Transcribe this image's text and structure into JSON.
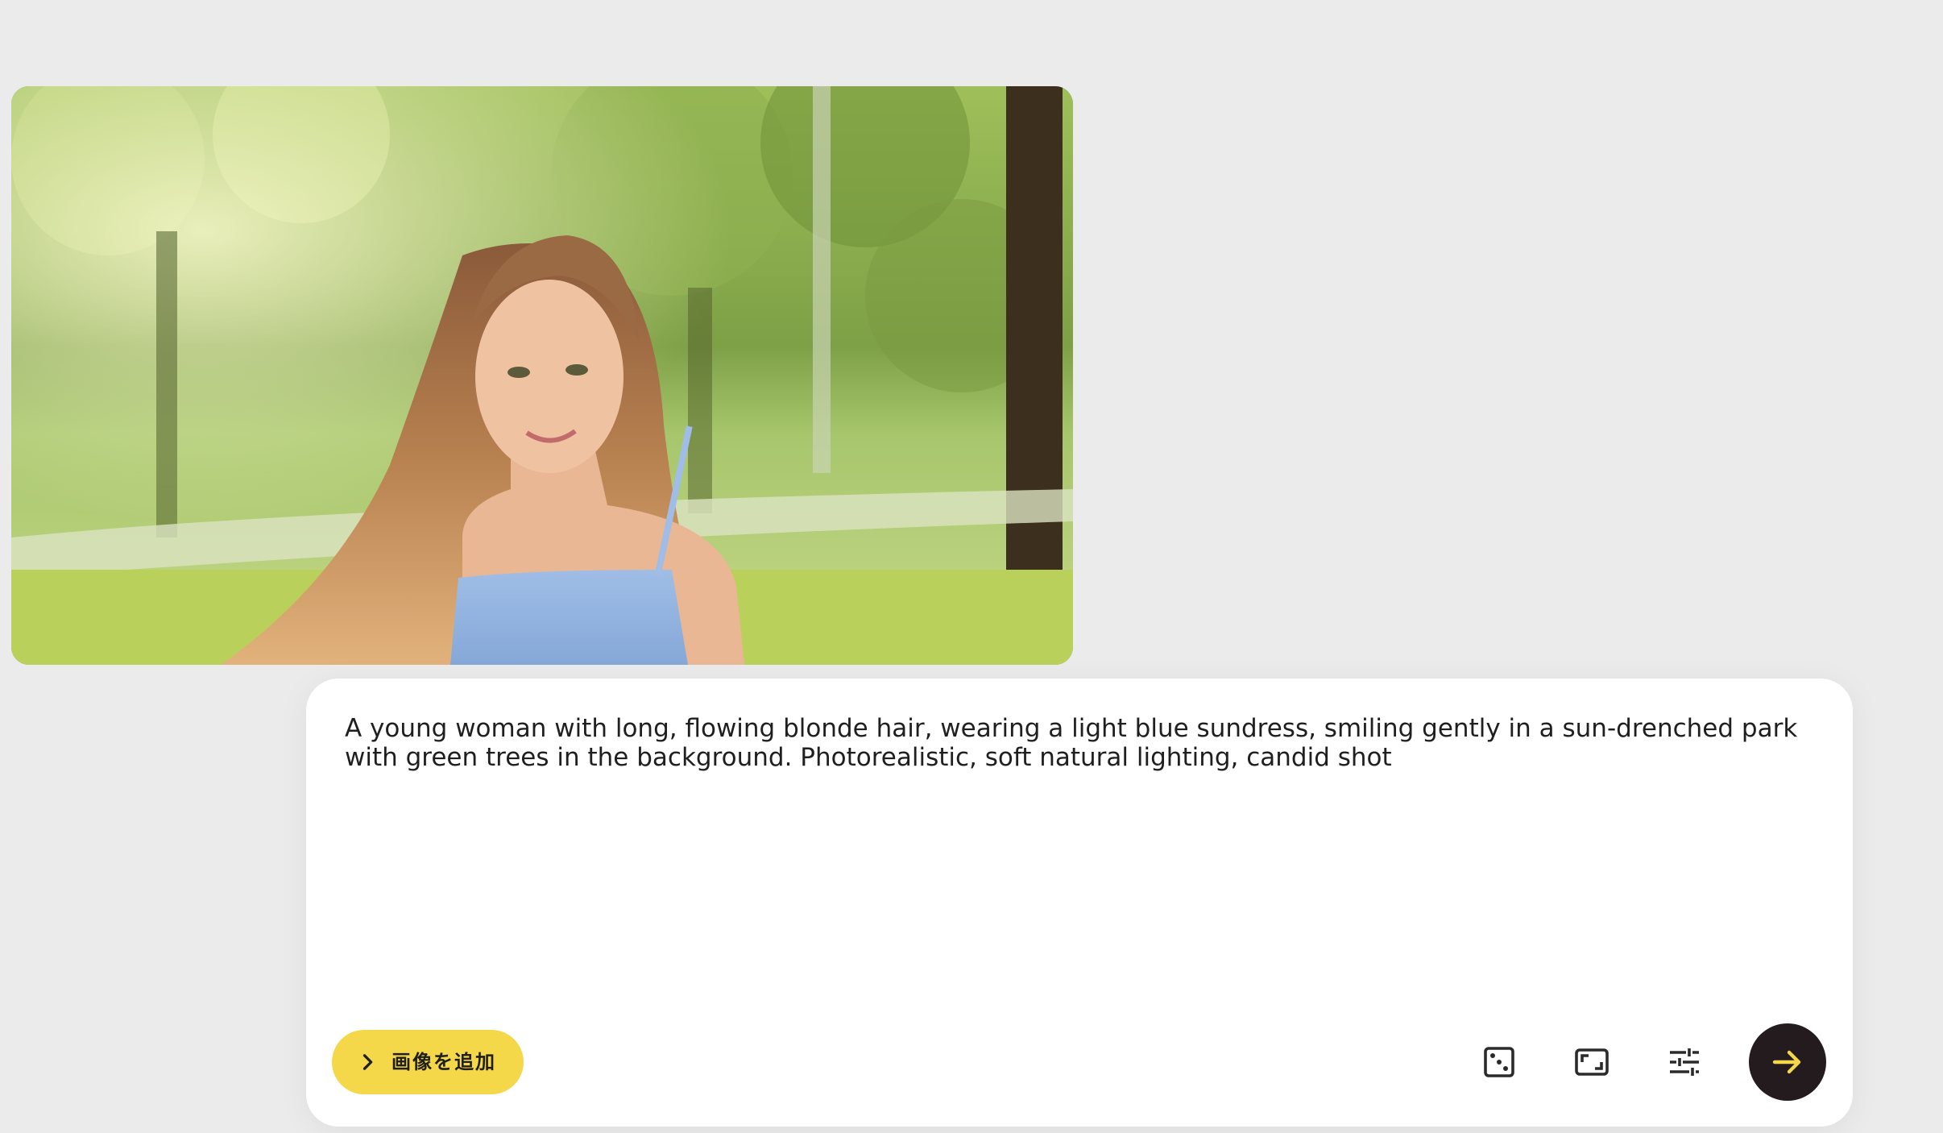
{
  "image": {
    "subject": "image"
  },
  "composer": {
    "prompt_text": "A young woman with long, flowing blonde hair, wearing a light blue sundress, smiling gently in a sun-drenched park with green trees in the background. Photorealistic, soft natural lighting, candid shot",
    "add_image_label": "画像を追加",
    "add_image_icon": "chevron-right-icon",
    "tools": [
      {
        "name": "dice-icon"
      },
      {
        "name": "aspect-ratio-icon"
      },
      {
        "name": "settings-sliders-icon"
      }
    ],
    "send_icon": "arrow-right-icon"
  },
  "colors": {
    "background": "#ebebeb",
    "composer_bg": "#ffffff",
    "accent_yellow": "#f5d74a",
    "send_button_bg": "#241b1f",
    "send_arrow": "#f5d74a"
  }
}
